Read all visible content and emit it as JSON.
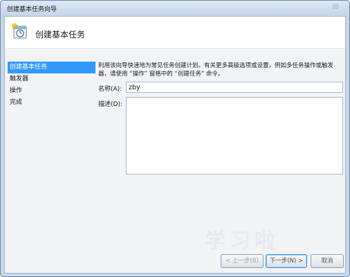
{
  "window": {
    "title": "创建基本任务向导",
    "close_label": "☒"
  },
  "header": {
    "title": "创建基本任务",
    "icon": "task-scheduler-icon"
  },
  "nav": {
    "items": [
      {
        "label": "创建基本任务",
        "active": true
      },
      {
        "label": "触发器",
        "active": false
      },
      {
        "label": "操作",
        "active": false
      },
      {
        "label": "完成",
        "active": false
      }
    ]
  },
  "content": {
    "description": "利用该向导快速地为常见任务创建计划。有关更多高级选项或设置，例如多任务操作或触发器，请使用 “操作” 窗格中的 “创建任务” 命令。",
    "name_label": "名称(A):",
    "name_value": "zby",
    "desc_label": "描述(D):",
    "desc_value": ""
  },
  "buttons": {
    "back": "< 上一步(B)",
    "next": "下一步(N) >",
    "cancel": "取消"
  },
  "watermark": "学习啦"
}
